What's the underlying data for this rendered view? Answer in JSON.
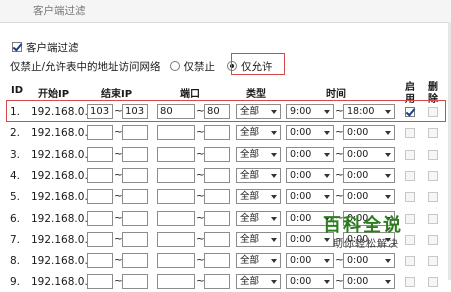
{
  "window": {
    "title": "客户端过滤"
  },
  "filter": {
    "enable_label": "客户端过滤",
    "enabled": true
  },
  "mode": {
    "prompt": "仅禁止/允许表中的地址访问网络",
    "options": [
      {
        "label": "仅禁止",
        "selected": false
      },
      {
        "label": "仅允许",
        "selected": true
      }
    ]
  },
  "table": {
    "headers": {
      "id": "ID",
      "start_ip": "开始IP",
      "end_ip": "结束IP",
      "port": "端口",
      "type": "类型",
      "time": "时间",
      "enable_top": "启",
      "enable_bottom": "用",
      "delete_top": "删",
      "delete_bottom": "除"
    },
    "separator": "~",
    "rows": [
      {
        "id": "1.",
        "ip_prefix": "192.168.0.",
        "start": "103",
        "end": "103",
        "port_from": "80",
        "port_to": "80",
        "type": "全部",
        "time_from": "9:00",
        "time_to": "18:00",
        "enabled": true
      },
      {
        "id": "2.",
        "ip_prefix": "192.168.0.",
        "start": "",
        "end": "",
        "port_from": "",
        "port_to": "",
        "type": "全部",
        "time_from": "0:00",
        "time_to": "0:00",
        "enabled": false
      },
      {
        "id": "3.",
        "ip_prefix": "192.168.0.",
        "start": "",
        "end": "",
        "port_from": "",
        "port_to": "",
        "type": "全部",
        "time_from": "0:00",
        "time_to": "0:00",
        "enabled": false
      },
      {
        "id": "4.",
        "ip_prefix": "192.168.0.",
        "start": "",
        "end": "",
        "port_from": "",
        "port_to": "",
        "type": "全部",
        "time_from": "0:00",
        "time_to": "0:00",
        "enabled": false
      },
      {
        "id": "5.",
        "ip_prefix": "192.168.0.",
        "start": "",
        "end": "",
        "port_from": "",
        "port_to": "",
        "type": "全部",
        "time_from": "0:00",
        "time_to": "0:00",
        "enabled": false
      },
      {
        "id": "6.",
        "ip_prefix": "192.168.0.",
        "start": "",
        "end": "",
        "port_from": "",
        "port_to": "",
        "type": "全部",
        "time_from": "0:00",
        "time_to": "0:00",
        "enabled": false
      },
      {
        "id": "7.",
        "ip_prefix": "192.168.0.",
        "start": "",
        "end": "",
        "port_from": "",
        "port_to": "",
        "type": "全部",
        "time_from": "0:00",
        "time_to": "0:00",
        "enabled": false
      },
      {
        "id": "8.",
        "ip_prefix": "192.168.0.",
        "start": "",
        "end": "",
        "port_from": "",
        "port_to": "",
        "type": "全部",
        "time_from": "0:00",
        "time_to": "0:00",
        "enabled": false
      },
      {
        "id": "9.",
        "ip_prefix": "192.168.0.",
        "start": "",
        "end": "",
        "port_from": "",
        "port_to": "",
        "type": "全部",
        "time_from": "0:00",
        "time_to": "0:00",
        "enabled": false
      }
    ]
  },
  "watermark": {
    "title": "百科全说",
    "subtitle": "助你轻松解决"
  },
  "colors": {
    "highlight": "#d84a4a",
    "watermark": "#2d7d1f"
  }
}
